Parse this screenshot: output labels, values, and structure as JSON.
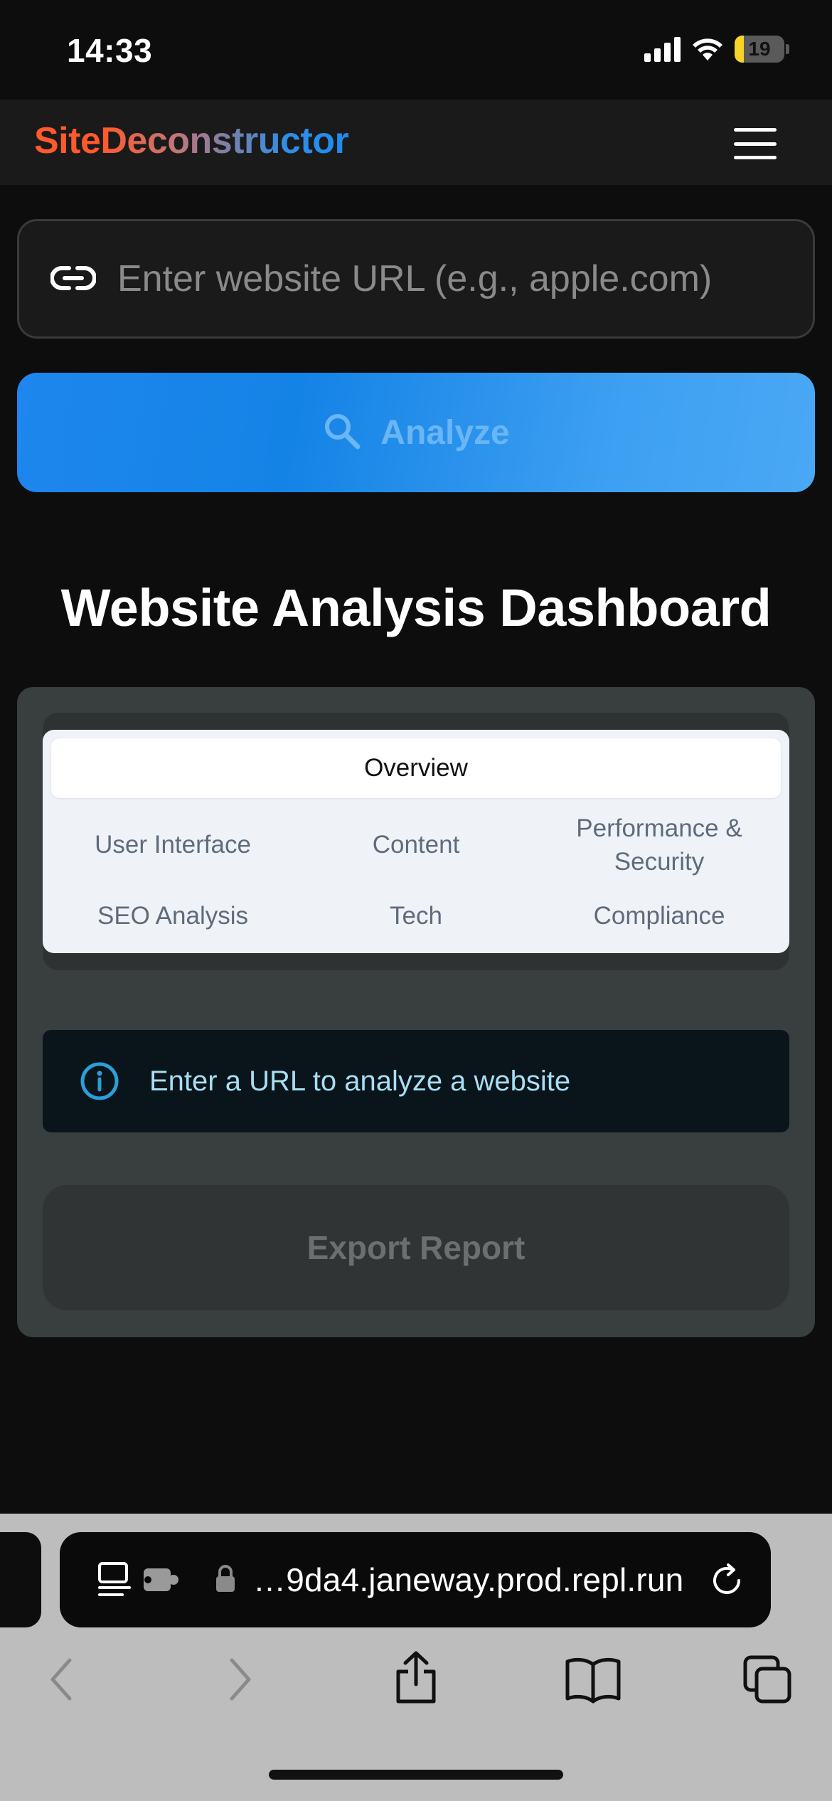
{
  "status_bar": {
    "time": "14:33",
    "battery_level": "19",
    "battery_fraction": 0.19,
    "icons": [
      "cellular-signal-icon",
      "wifi-icon",
      "battery-icon"
    ]
  },
  "header": {
    "brand": "SiteDeconstructor",
    "brand_colors": [
      "#ff5a2c",
      "#1d8cf0"
    ],
    "menu_icon": "hamburger-menu-icon"
  },
  "search": {
    "placeholder": "Enter website URL (e.g., apple.com)",
    "value": "",
    "icon": "link-icon"
  },
  "analyze_button": {
    "label": "Analyze",
    "icon": "search-icon",
    "color": "#1e86ee"
  },
  "main": {
    "title": "Website Analysis Dashboard",
    "tabs": [
      {
        "label": "Overview",
        "active": true
      },
      {
        "label": "User Interface",
        "active": false
      },
      {
        "label": "Content",
        "active": false
      },
      {
        "label": "Performance & Security",
        "active": false
      },
      {
        "label": "SEO Analysis",
        "active": false
      },
      {
        "label": "Tech",
        "active": false
      },
      {
        "label": "Compliance",
        "active": false
      }
    ],
    "info_alert": {
      "text": "Enter a URL to analyze a website",
      "icon": "info-icon",
      "color": "#2a9fd8"
    },
    "export_button": {
      "label": "Export Report"
    }
  },
  "browser": {
    "address": "…9da4.janeway.prod.repl.run",
    "toolbar": [
      "back-icon",
      "forward-icon",
      "share-icon",
      "bookmarks-icon",
      "tabs-icon"
    ]
  }
}
